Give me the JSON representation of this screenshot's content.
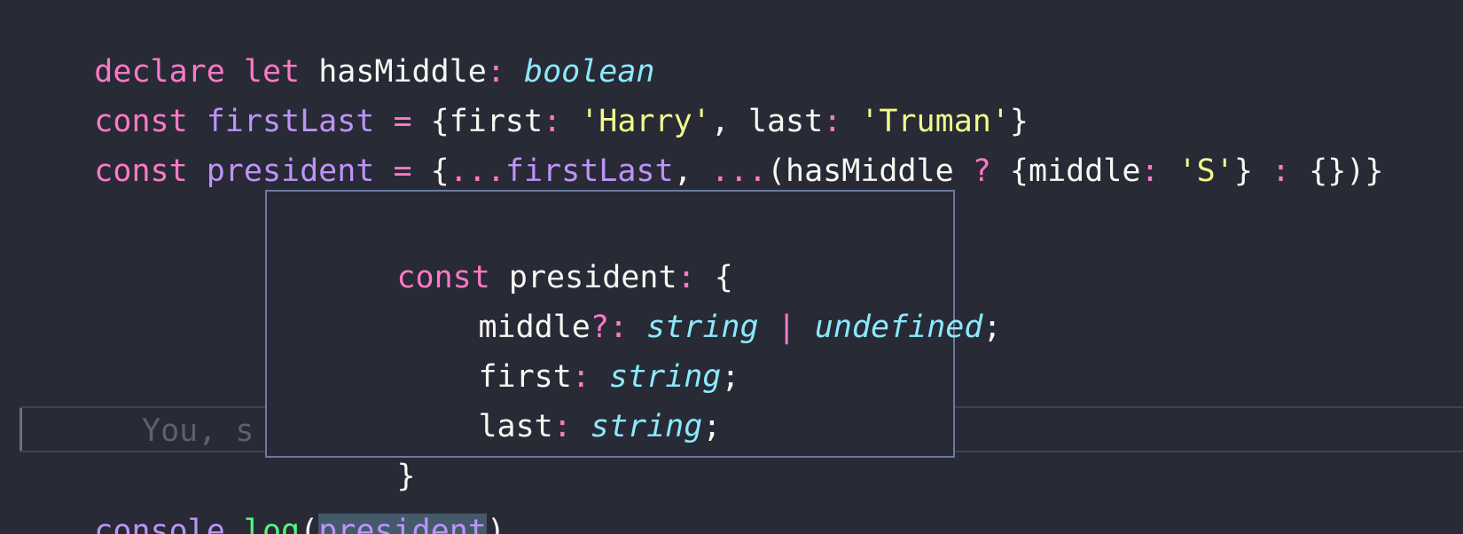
{
  "code": {
    "line1": {
      "kw_declare": "declare",
      "kw_let": "let",
      "name": "hasMiddle",
      "colon": ":",
      "type": "boolean"
    },
    "line2": {
      "kw_const": "const",
      "name": "firstLast",
      "eq": "=",
      "open": "{",
      "key_first": "first",
      "colon1": ":",
      "str_first": "'Harry'",
      "comma": ",",
      "key_last": "last",
      "colon2": ":",
      "str_last": "'Truman'",
      "close": "}"
    },
    "line3": {
      "kw_const": "const",
      "name": "president",
      "eq": "=",
      "open": "{",
      "spread1": "...",
      "spread1_name": "firstLast",
      "comma": ",",
      "spread2": "...",
      "paren_open": "(",
      "cond_name": "hasMiddle",
      "q": "?",
      "obj_open": "{",
      "key_middle": "middle",
      "colon": ":",
      "str_middle": "'S'",
      "obj_close": "}",
      "alt": ":",
      "empty_obj": "{}",
      "paren_close": ")",
      "close": "}"
    },
    "line_console": {
      "obj": "console",
      "dot": ".",
      "method": "log",
      "paren_open": "(",
      "arg": "president",
      "paren_close": ")"
    }
  },
  "blame": {
    "text": "You, s"
  },
  "hover": {
    "line1": {
      "kw": "const",
      "name": "president",
      "colon": ":",
      "open": "{"
    },
    "line2": {
      "key": "middle",
      "opt": "?:",
      "type1": "string",
      "pipe": "|",
      "type2": "undefined",
      "semi": ";"
    },
    "line3": {
      "key": "first",
      "colon": ":",
      "type": "string",
      "semi": ";"
    },
    "line4": {
      "key": "last",
      "colon": ":",
      "type": "string",
      "semi": ";"
    },
    "line5": {
      "close": "}"
    }
  },
  "colors": {
    "background": "#282a36",
    "keyword": "#ff79c6",
    "variable": "#bd93f9",
    "string": "#f1fa8c",
    "type": "#8be9fd",
    "function": "#50fa7b",
    "selection": "#44596a",
    "popup_border": "#6b7aa1"
  }
}
